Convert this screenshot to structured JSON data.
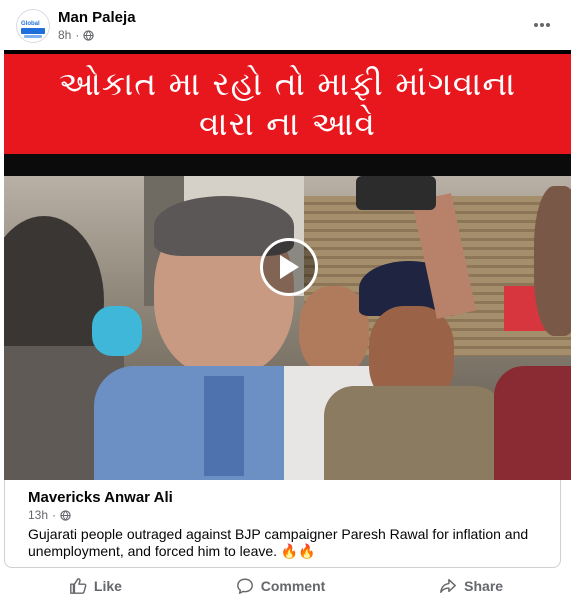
{
  "post": {
    "author": "Man Paleja",
    "time": "8h",
    "privacy_icon": "globe-icon",
    "more_icon": "more-options-icon"
  },
  "video": {
    "banner_line1": "ઓકાત મા રહો તો માફી માંગવાના",
    "banner_line2": "વારા ના આવે",
    "banner_color": "#e8171e",
    "play_icon": "play-icon"
  },
  "shared": {
    "author": "Mavericks Anwar Ali",
    "time": "13h",
    "text": "Gujarati people outraged against BJP campaigner Paresh Rawal for inflation and unemployment, and forced him to leave. 🔥🔥"
  },
  "actions": {
    "like": "Like",
    "comment": "Comment",
    "share": "Share"
  }
}
